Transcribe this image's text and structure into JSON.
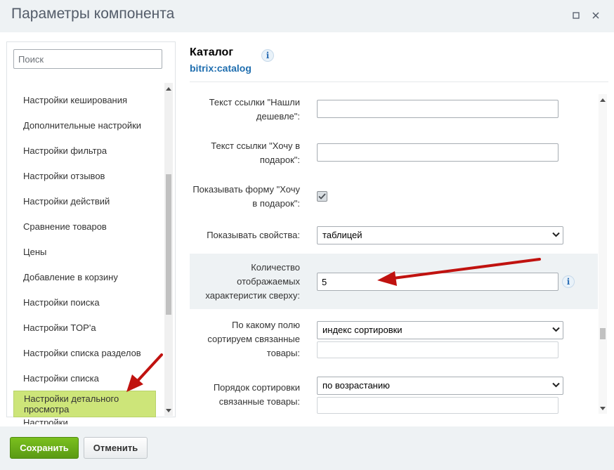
{
  "window": {
    "title": "Параметры компонента"
  },
  "sidebar": {
    "search_placeholder": "Поиск",
    "items": [
      {
        "label": "Настройки кеширования"
      },
      {
        "label": "Дополнительные настройки"
      },
      {
        "label": "Настройки фильтра"
      },
      {
        "label": "Настройки отзывов"
      },
      {
        "label": "Настройки действий"
      },
      {
        "label": "Сравнение товаров"
      },
      {
        "label": "Цены"
      },
      {
        "label": "Добавление в корзину"
      },
      {
        "label": "Настройки поиска"
      },
      {
        "label": "Настройки TOP'а"
      },
      {
        "label": "Настройки списка разделов"
      },
      {
        "label": "Настройки списка"
      },
      {
        "label": "Настройки детального просмотра",
        "active": true
      },
      {
        "label": "Настройки..."
      }
    ]
  },
  "component": {
    "title": "Каталог",
    "code": "bitrix:catalog"
  },
  "form": {
    "fields": [
      {
        "label": "Текст ссылки \"Нашли дешевле\":",
        "type": "text",
        "value": ""
      },
      {
        "label": "Текст ссылки \"Хочу в подарок\":",
        "type": "text",
        "value": ""
      },
      {
        "label": "Показывать форму \"Хочу в подарок\":",
        "type": "checkbox",
        "checked": true
      },
      {
        "label": "Показывать свойства:",
        "type": "select",
        "value": "таблицей"
      },
      {
        "label": "Количество отображаемых характеристик сверху:",
        "type": "text",
        "value": "5",
        "highlighted": true
      },
      {
        "label": "По какому полю сортируем связанные товары:",
        "type": "select",
        "value": "индекс сортировки",
        "extra_value": ""
      },
      {
        "label": "Порядок сортировки связанные товары:",
        "type": "select",
        "value": "по возрастанию",
        "extra_value": ""
      }
    ]
  },
  "footer": {
    "save_label": "Сохранить",
    "cancel_label": "Отменить"
  },
  "colors": {
    "accent_green": "#cde579",
    "save_button": "#6aae18",
    "link_blue": "#1f6eaf",
    "arrow_red": "#c0120f"
  }
}
